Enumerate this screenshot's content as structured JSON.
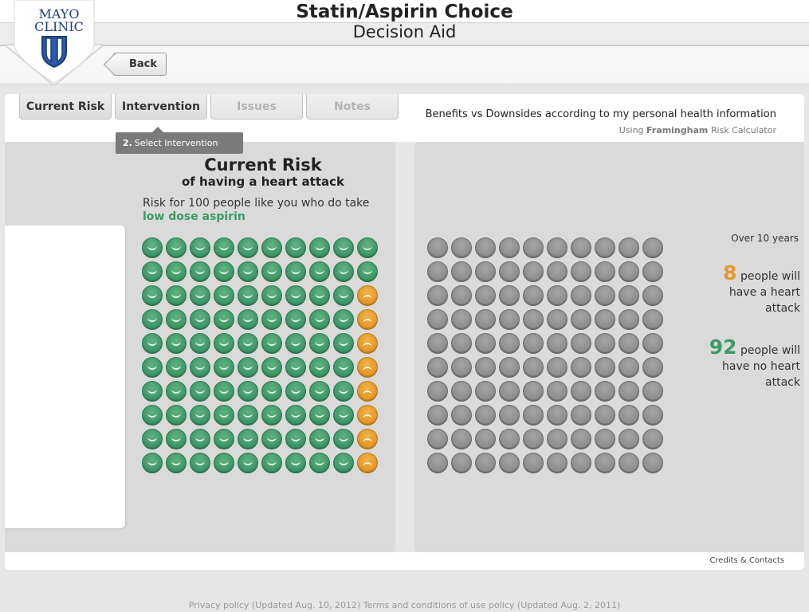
{
  "header": {
    "title": "Statin/Aspirin Choice",
    "subtitle": "Decision Aid",
    "logo_text_line1": "MAYO",
    "logo_text_line2": "CLINIC",
    "back_label": "Back"
  },
  "tabs": [
    {
      "label": "Current Risk",
      "state": "active"
    },
    {
      "label": "Intervention",
      "state": "active"
    },
    {
      "label": "Issues",
      "state": "disabled"
    },
    {
      "label": "Notes",
      "state": "disabled"
    }
  ],
  "tooltip": {
    "step": "2.",
    "text": "Select Intervention"
  },
  "benefits": {
    "title": "Benefits vs Downsides according to my personal health information",
    "calc_prefix": "Using ",
    "calc_name": "Framingham",
    "calc_suffix": " Risk Calculator"
  },
  "risk": {
    "heading": "Current Risk",
    "subheading": "of having a heart attack",
    "desc": "Risk for 100 people like you who do take ",
    "desc_highlight": "low dose aspirin",
    "period": "Over 10 years",
    "heart_attack_count": "8",
    "heart_attack_text": " people will have a heart attack",
    "no_attack_count": "92",
    "no_attack_text": " people will have no heart attack"
  },
  "icon_array": {
    "total": 100,
    "affected": 8,
    "affected_column": 10,
    "affected_rows": [
      3,
      4,
      5,
      6,
      7,
      8,
      9,
      10
    ],
    "unaffected_color": "#3d9565",
    "affected_color": "#e3972b",
    "neutral_color": "#8d8d8d"
  },
  "credits": "Credits & Contacts",
  "footer": "Privacy policy (Updated Aug. 10, 2012) Terms and conditions of use policy (Updated Aug. 2, 2011)"
}
